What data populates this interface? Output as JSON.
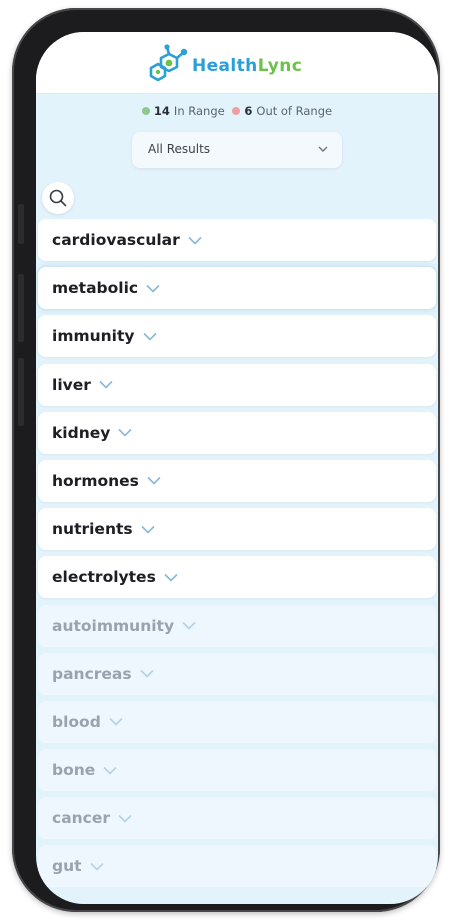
{
  "brand": {
    "name_part1": "Health",
    "name_part2": "Lync"
  },
  "summary": {
    "in_range_count": "14",
    "in_range_label": "In Range",
    "out_range_count": "6",
    "out_range_label": "Out of Range"
  },
  "filter": {
    "selected": "All Results"
  },
  "categories": [
    {
      "label": "cardiovascular"
    },
    {
      "label": "metabolic"
    },
    {
      "label": "immunity"
    },
    {
      "label": "liver"
    },
    {
      "label": "kidney"
    },
    {
      "label": "hormones"
    },
    {
      "label": "nutrients"
    },
    {
      "label": "electrolytes"
    },
    {
      "label": "autoimmunity"
    },
    {
      "label": "pancreas"
    },
    {
      "label": "blood"
    },
    {
      "label": "bone"
    },
    {
      "label": "cancer"
    },
    {
      "label": "gut"
    }
  ],
  "colors": {
    "brand_blue": "#2a9fd8",
    "brand_green": "#6cc24a",
    "in_range": "#8dc98f",
    "out_range": "#f0a0a0",
    "screen_bg": "#e3f3fc",
    "chevron": "#8ab8d6"
  }
}
